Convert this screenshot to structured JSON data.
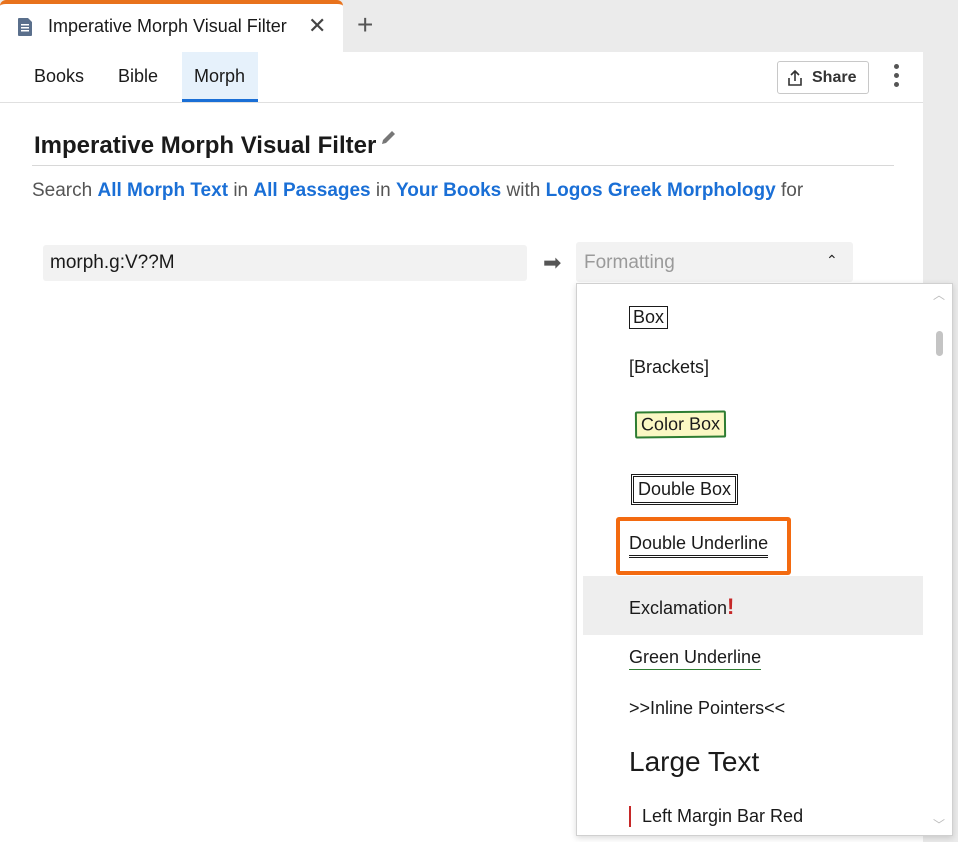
{
  "tab": {
    "title": "Imperative Morph Visual Filter",
    "close": "✕",
    "add": "+"
  },
  "subtabs": {
    "books": "Books",
    "bible": "Bible",
    "morph": "Morph"
  },
  "share_label": "Share",
  "page_title": "Imperative Morph Visual Filter",
  "search_line": {
    "prefix": "Search",
    "target": "All Morph Text",
    "in1": "in",
    "range": "All Passages",
    "in2": "in",
    "source": "Your Books",
    "with": "with",
    "morphology": "Logos Greek Morphology",
    "for": "for"
  },
  "query_value": "morph.g:V??M",
  "arrow": "➡",
  "formatting": {
    "placeholder": "Formatting",
    "chevron": "⌃"
  },
  "options": {
    "box": "Box",
    "brackets": "[Brackets]",
    "color_box": "Color Box",
    "double_box": "Double Box",
    "double_underline": "Double Underline",
    "exclamation": "Exclamation",
    "exclamation_mark": "!",
    "green_underline": "Green Underline",
    "inline_pointers": ">>Inline Pointers<<",
    "large_text": "Large Text",
    "left_margin_bar_red": "Left Margin Bar Red"
  },
  "colors": {
    "accent": "#1a6fd6",
    "tab_accent": "#e8721c",
    "highlight": "#f36a10",
    "green": "#2e7d32",
    "red": "#c62828"
  }
}
